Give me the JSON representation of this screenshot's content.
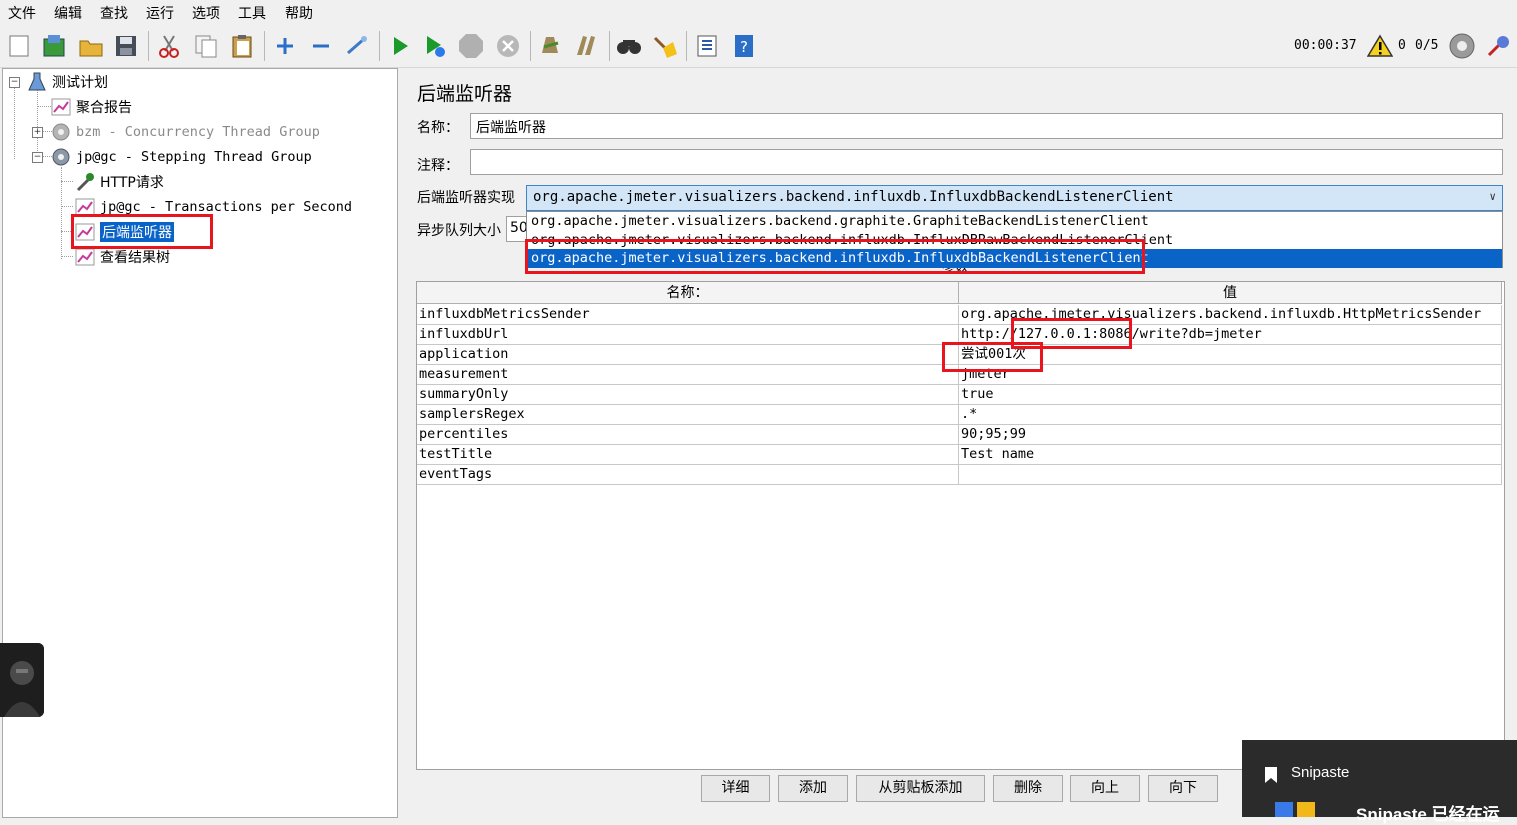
{
  "menu": [
    "文件",
    "编辑",
    "查找",
    "运行",
    "选项",
    "工具",
    "帮助"
  ],
  "toolbar": {
    "timer": "00:00:37",
    "error_count": "0",
    "threads": "0/5",
    "icons": [
      "new-icon",
      "templates-icon",
      "open-icon",
      "save-icon",
      "cut-icon",
      "copy-icon",
      "paste-icon",
      "expand-icon",
      "collapse-icon",
      "toggle-icon",
      "start-icon",
      "start-no-pause-icon",
      "stop-icon",
      "shutdown-icon",
      "clear-icon",
      "clear-all-icon",
      "search-icon",
      "reset-search-icon",
      "function-helper-icon",
      "help-icon"
    ]
  },
  "tree": {
    "items": [
      {
        "label": "测试计划"
      },
      {
        "label": "聚合报告"
      },
      {
        "label": "bzm - Concurrency Thread Group"
      },
      {
        "label": "jp@gc - Stepping Thread Group"
      },
      {
        "label": "HTTP请求"
      },
      {
        "label": "jp@gc - Transactions per Second"
      },
      {
        "label": "后端监听器"
      },
      {
        "label": "查看结果树"
      }
    ]
  },
  "panel": {
    "title": "后端监听器",
    "name_label": "名称：",
    "name_value": "后端监听器",
    "comment_label": "注释：",
    "comment_value": "",
    "impl_label": "后端监听器实现",
    "impl_value": "org.apache.jmeter.visualizers.backend.influxdb.InfluxdbBackendListenerClient",
    "queue_label": "异步队列大小",
    "queue_value": "50",
    "params_partial": "参数",
    "options": [
      "org.apache.jmeter.visualizers.backend.graphite.GraphiteBackendListenerClient",
      "org.apache.jmeter.visualizers.backend.influxdb.InfluxDBRawBackendListenerClient",
      "org.apache.jmeter.visualizers.backend.influxdb.InfluxdbBackendListenerClient"
    ],
    "table": {
      "headers": [
        "名称：",
        "值"
      ],
      "rows": [
        [
          "influxdbMetricsSender",
          "org.apache.jmeter.visualizers.backend.influxdb.HttpMetricsSender"
        ],
        [
          "influxdbUrl",
          "http://127.0.0.1:8086/write?db=jmeter"
        ],
        [
          "application",
          "尝试001次"
        ],
        [
          "measurement",
          "jmeter"
        ],
        [
          "summaryOnly",
          "true"
        ],
        [
          "samplersRegex",
          ".*"
        ],
        [
          "percentiles",
          "90;95;99"
        ],
        [
          "testTitle",
          "Test name"
        ],
        [
          "eventTags",
          ""
        ]
      ]
    },
    "buttons": [
      "详细",
      "添加",
      "从剪贴板添加",
      "删除",
      "向上",
      "向下"
    ]
  },
  "snipaste": {
    "title": "Snipaste",
    "message": "Snipaste 已经在运"
  }
}
